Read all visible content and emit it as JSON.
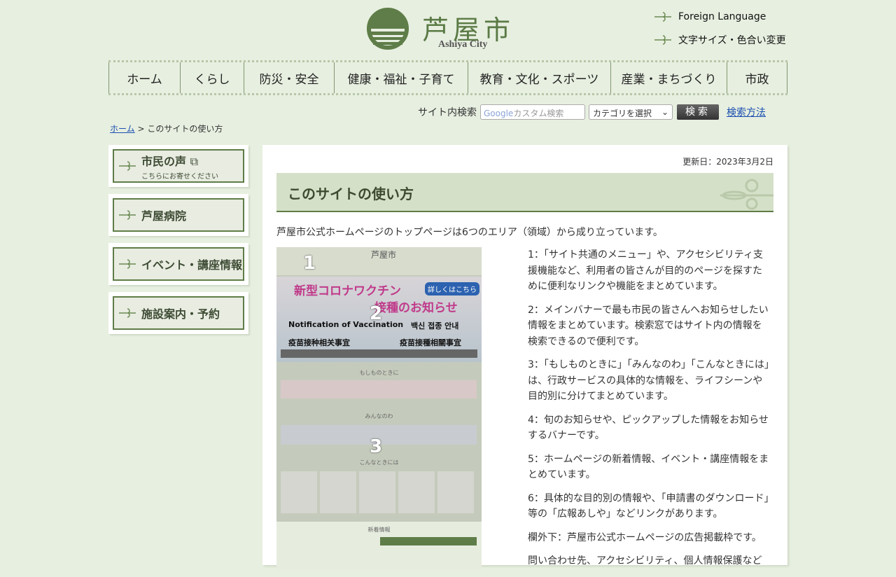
{
  "header": {
    "logo_text": "芦屋市",
    "logo_sub": "Ashiya City",
    "links": [
      "Foreign Language",
      "文字サイズ・色合い変更"
    ]
  },
  "nav": [
    "ホーム",
    "くらし",
    "防災・安全",
    "健康・福祉・子育て",
    "教育・文化・スポーツ",
    "産業・まちづくり",
    "市政"
  ],
  "search": {
    "label": "サイト内検索",
    "google": "Google",
    "placeholder": "カスタム検索",
    "category": "カテゴリを選択",
    "button": "検索",
    "help": "検索方法"
  },
  "breadcrumb": {
    "home": "ホーム",
    "sep": ">",
    "current": "このサイトの使い方"
  },
  "sidebar": [
    {
      "label": "市民の声",
      "sub": "こちらにお寄せください"
    },
    {
      "label": "芦屋病院"
    },
    {
      "label": "イベント・講座情報"
    },
    {
      "label": "施設案内・予約"
    }
  ],
  "main": {
    "updated": "更新日：2023年3月2日",
    "title": "このサイトの使い方",
    "intro": "芦屋市公式ホームページのトップページは6つのエリア（領域）から成り立っています。",
    "items": [
      "1：「サイト共通のメニュー」や、アクセシビリティ支援機能など、利用者の皆さんが目的のページを探すために便利なリンクや機能をまとめています。",
      "2：メインバナーで最も市民の皆さんへお知らせしたい情報をまとめています。検索窓ではサイト内の情報を検索できるので便利です。",
      "3：「もしものときに」「みんなのわ」「こんなときには」は、行政サービスの具体的な情報を、ライフシーンや目的別に分けてまとめています。",
      "4：旬のお知らせや、ピックアップした情報をお知らせするバナーです。",
      "5：ホームページの新着情報、イベント・講座情報をまとめています。",
      "6：具体的な目的別の情報や、「申請書のダウンロード」等の「広報あしや」などリンクがあります。",
      "欄外下：芦屋市公式ホームページの広告掲載枠です。",
      "問い合わせ先、アクセシビリティ、個人情報保護など"
    ]
  },
  "thumbnail": {
    "labels": [
      "1",
      "2",
      "3"
    ],
    "banner1": "新型コロナワクチン",
    "banner2": "接種のお知らせ",
    "banner_en": "Notification of Vaccination",
    "banner_ko": "백신 접종 안내",
    "banner_zh1": "疫苗接种相关事宜",
    "banner_zh2": "疫苗接種相關事宜",
    "detail": "詳しくはこちら",
    "sections": [
      "もしものときに",
      "みんなのわ",
      "こんなときには",
      "新着情報"
    ]
  },
  "colors": {
    "bg": "#e7efe0",
    "accent": "#5f7d48"
  }
}
